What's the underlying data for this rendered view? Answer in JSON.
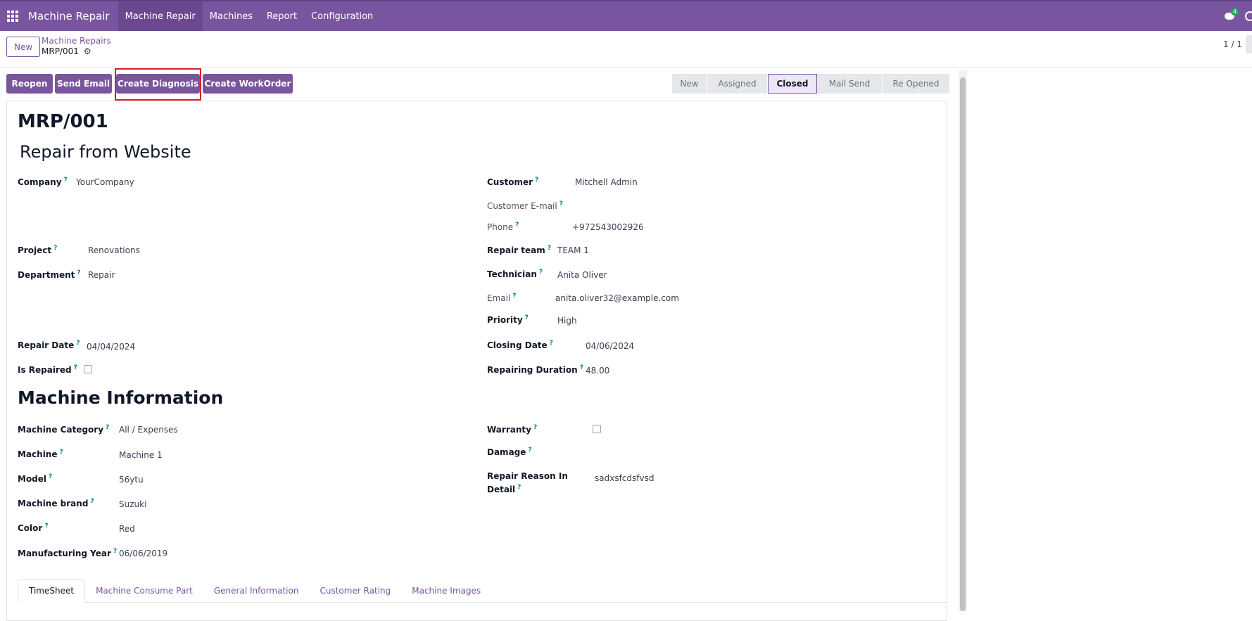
{
  "navbar": {
    "brand": "Machine Repair",
    "menu": [
      "Machine Repair",
      "Machines",
      "Report",
      "Configuration"
    ],
    "chat_badge": "4"
  },
  "control": {
    "new_label": "New",
    "breadcrumb_parent": "Machine Repairs",
    "breadcrumb_current": "MRP/001",
    "pager": "1 / 1"
  },
  "actions": [
    "Reopen",
    "Send Email",
    "Create Diagnosis",
    "Create WorkOrder"
  ],
  "stages": {
    "items": [
      "New",
      "Assigned",
      "Closed",
      "Mail Send",
      "Re Opened"
    ],
    "current": "Closed"
  },
  "form": {
    "title": "MRP/001",
    "subtitle": "Repair from Website",
    "left": {
      "company_label": "Company",
      "company": "YourCompany",
      "project_label": "Project",
      "project": "Renovations",
      "department_label": "Department",
      "department": "Repair",
      "repair_date_label": "Repair Date",
      "repair_date": "04/04/2024",
      "is_repaired_label": "Is Repaired"
    },
    "right": {
      "customer_label": "Customer",
      "customer": "Mitchell Admin",
      "customer_email_label": "Customer E-mail",
      "phone_label": "Phone",
      "phone": "+972543002926",
      "repair_team_label": "Repair team",
      "repair_team": "TEAM 1",
      "technician_label": "Technician",
      "technician": "Anita Oliver",
      "email_label": "Email",
      "email": "anita.oliver32@example.com",
      "priority_label": "Priority",
      "priority": "High",
      "closing_date_label": "Closing Date",
      "closing_date": "04/06/2024",
      "duration_label": "Repairing Duration",
      "duration": "48.00"
    },
    "machine_section": "Machine Information",
    "machine": {
      "category_label": "Machine Category",
      "category": "All / Expenses",
      "machine_label": "Machine",
      "machine": "Machine 1",
      "model_label": "Model",
      "model": "56ytu",
      "brand_label": "Machine brand",
      "brand": "Suzuki",
      "color_label": "Color",
      "color": "Red",
      "year_label": "Manufacturing Year",
      "year": "06/06/2019",
      "warranty_label": "Warranty",
      "damage_label": "Damage",
      "reason_label_1": "Repair Reason In",
      "reason_label_2": "Detail",
      "reason": "sadxsfcdsfvsd"
    },
    "tabs": [
      "TimeSheet",
      "Machine Consume Part",
      "General Information",
      "Customer Rating",
      "Machine Images"
    ]
  },
  "colors": {
    "brand": "#7a559f",
    "highlight": "#e11d24",
    "help": "#017e84"
  }
}
